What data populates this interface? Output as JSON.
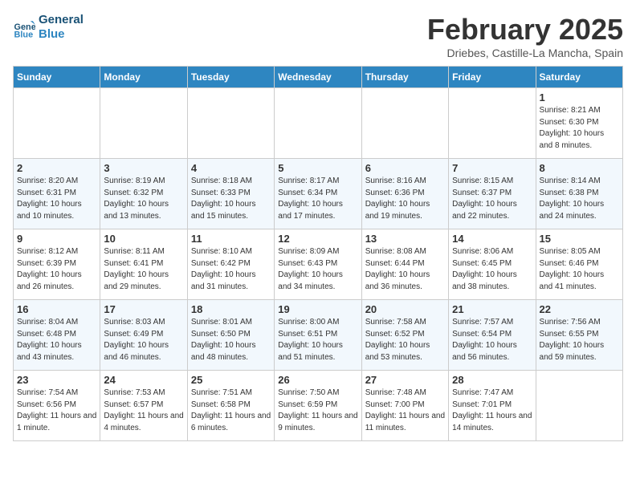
{
  "header": {
    "logo_line1": "General",
    "logo_line2": "Blue",
    "title": "February 2025",
    "subtitle": "Driebes, Castille-La Mancha, Spain"
  },
  "weekdays": [
    "Sunday",
    "Monday",
    "Tuesday",
    "Wednesday",
    "Thursday",
    "Friday",
    "Saturday"
  ],
  "weeks": [
    [
      {
        "day": "",
        "info": ""
      },
      {
        "day": "",
        "info": ""
      },
      {
        "day": "",
        "info": ""
      },
      {
        "day": "",
        "info": ""
      },
      {
        "day": "",
        "info": ""
      },
      {
        "day": "",
        "info": ""
      },
      {
        "day": "1",
        "info": "Sunrise: 8:21 AM\nSunset: 6:30 PM\nDaylight: 10 hours and 8 minutes."
      }
    ],
    [
      {
        "day": "2",
        "info": "Sunrise: 8:20 AM\nSunset: 6:31 PM\nDaylight: 10 hours and 10 minutes."
      },
      {
        "day": "3",
        "info": "Sunrise: 8:19 AM\nSunset: 6:32 PM\nDaylight: 10 hours and 13 minutes."
      },
      {
        "day": "4",
        "info": "Sunrise: 8:18 AM\nSunset: 6:33 PM\nDaylight: 10 hours and 15 minutes."
      },
      {
        "day": "5",
        "info": "Sunrise: 8:17 AM\nSunset: 6:34 PM\nDaylight: 10 hours and 17 minutes."
      },
      {
        "day": "6",
        "info": "Sunrise: 8:16 AM\nSunset: 6:36 PM\nDaylight: 10 hours and 19 minutes."
      },
      {
        "day": "7",
        "info": "Sunrise: 8:15 AM\nSunset: 6:37 PM\nDaylight: 10 hours and 22 minutes."
      },
      {
        "day": "8",
        "info": "Sunrise: 8:14 AM\nSunset: 6:38 PM\nDaylight: 10 hours and 24 minutes."
      }
    ],
    [
      {
        "day": "9",
        "info": "Sunrise: 8:12 AM\nSunset: 6:39 PM\nDaylight: 10 hours and 26 minutes."
      },
      {
        "day": "10",
        "info": "Sunrise: 8:11 AM\nSunset: 6:41 PM\nDaylight: 10 hours and 29 minutes."
      },
      {
        "day": "11",
        "info": "Sunrise: 8:10 AM\nSunset: 6:42 PM\nDaylight: 10 hours and 31 minutes."
      },
      {
        "day": "12",
        "info": "Sunrise: 8:09 AM\nSunset: 6:43 PM\nDaylight: 10 hours and 34 minutes."
      },
      {
        "day": "13",
        "info": "Sunrise: 8:08 AM\nSunset: 6:44 PM\nDaylight: 10 hours and 36 minutes."
      },
      {
        "day": "14",
        "info": "Sunrise: 8:06 AM\nSunset: 6:45 PM\nDaylight: 10 hours and 38 minutes."
      },
      {
        "day": "15",
        "info": "Sunrise: 8:05 AM\nSunset: 6:46 PM\nDaylight: 10 hours and 41 minutes."
      }
    ],
    [
      {
        "day": "16",
        "info": "Sunrise: 8:04 AM\nSunset: 6:48 PM\nDaylight: 10 hours and 43 minutes."
      },
      {
        "day": "17",
        "info": "Sunrise: 8:03 AM\nSunset: 6:49 PM\nDaylight: 10 hours and 46 minutes."
      },
      {
        "day": "18",
        "info": "Sunrise: 8:01 AM\nSunset: 6:50 PM\nDaylight: 10 hours and 48 minutes."
      },
      {
        "day": "19",
        "info": "Sunrise: 8:00 AM\nSunset: 6:51 PM\nDaylight: 10 hours and 51 minutes."
      },
      {
        "day": "20",
        "info": "Sunrise: 7:58 AM\nSunset: 6:52 PM\nDaylight: 10 hours and 53 minutes."
      },
      {
        "day": "21",
        "info": "Sunrise: 7:57 AM\nSunset: 6:54 PM\nDaylight: 10 hours and 56 minutes."
      },
      {
        "day": "22",
        "info": "Sunrise: 7:56 AM\nSunset: 6:55 PM\nDaylight: 10 hours and 59 minutes."
      }
    ],
    [
      {
        "day": "23",
        "info": "Sunrise: 7:54 AM\nSunset: 6:56 PM\nDaylight: 11 hours and 1 minute."
      },
      {
        "day": "24",
        "info": "Sunrise: 7:53 AM\nSunset: 6:57 PM\nDaylight: 11 hours and 4 minutes."
      },
      {
        "day": "25",
        "info": "Sunrise: 7:51 AM\nSunset: 6:58 PM\nDaylight: 11 hours and 6 minutes."
      },
      {
        "day": "26",
        "info": "Sunrise: 7:50 AM\nSunset: 6:59 PM\nDaylight: 11 hours and 9 minutes."
      },
      {
        "day": "27",
        "info": "Sunrise: 7:48 AM\nSunset: 7:00 PM\nDaylight: 11 hours and 11 minutes."
      },
      {
        "day": "28",
        "info": "Sunrise: 7:47 AM\nSunset: 7:01 PM\nDaylight: 11 hours and 14 minutes."
      },
      {
        "day": "",
        "info": ""
      }
    ]
  ]
}
